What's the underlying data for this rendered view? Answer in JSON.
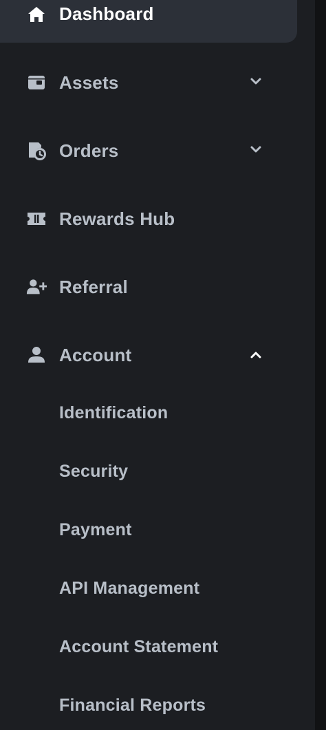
{
  "sidebar": {
    "items": [
      {
        "id": "dashboard",
        "label": "Dashboard",
        "icon": "home-icon",
        "active": true
      },
      {
        "id": "assets",
        "label": "Assets",
        "icon": "wallet-icon",
        "chevron": "down"
      },
      {
        "id": "orders",
        "label": "Orders",
        "icon": "order-history-icon",
        "chevron": "down"
      },
      {
        "id": "rewards",
        "label": "Rewards Hub",
        "icon": "ticket-icon"
      },
      {
        "id": "referral",
        "label": "Referral",
        "icon": "add-user-icon"
      },
      {
        "id": "account",
        "label": "Account",
        "icon": "user-icon",
        "chevron": "up",
        "expanded": true
      }
    ],
    "account_sub_items": [
      {
        "label": "Identification"
      },
      {
        "label": "Security"
      },
      {
        "label": "Payment"
      },
      {
        "label": "API Management"
      },
      {
        "label": "Account Statement"
      },
      {
        "label": "Financial Reports"
      }
    ]
  },
  "colors": {
    "background": "#1c1e22",
    "active_background": "#2c3038",
    "text": "#b8bfc8",
    "active_text": "#ffffff"
  }
}
